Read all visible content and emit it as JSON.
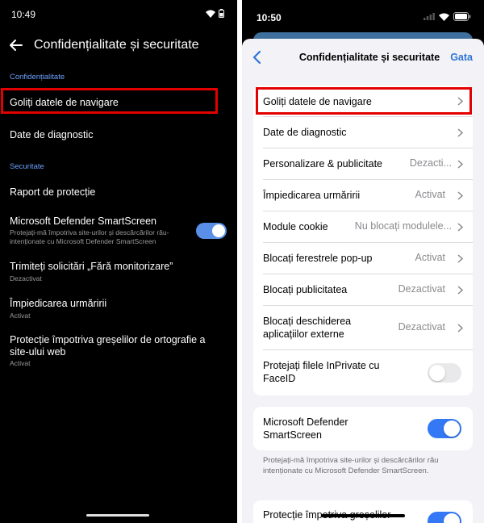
{
  "android": {
    "status_time": "10:49",
    "title": "Confidențialitate și securitate",
    "section_privacy": "Confidențialitate",
    "section_security": "Securitate",
    "items": [
      {
        "title": "Goliți datele de navigare"
      },
      {
        "title": "Date de diagnostic"
      },
      {
        "title": "Raport de protecție"
      },
      {
        "title": "Microsoft Defender SmartScreen",
        "subtitle": "Protejați-mă împotriva site-urilor și descărcărilor rău-intenționate cu Microsoft Defender SmartScreen",
        "toggle": true
      },
      {
        "title": "Trimiteți solicitări „Fără monitorizare”",
        "subtitle": "Dezactivat"
      },
      {
        "title": "Împiedicarea urmăririi",
        "subtitle": "Activat"
      },
      {
        "title": "Protecție împotriva greșelilor de ortografie a site-ului web",
        "subtitle": "Activat"
      }
    ],
    "colors": {
      "accent": "#6ea0ff",
      "toggle_on": "#5a8fe8",
      "highlight": "#e30000"
    }
  },
  "ios": {
    "status_time": "10:50",
    "title": "Confidențialitate și securitate",
    "done_label": "Gata",
    "rows": [
      {
        "label": "Goliți datele de navigare",
        "value": ""
      },
      {
        "label": "Date de diagnostic",
        "value": ""
      },
      {
        "label": "Personalizare & publicitate",
        "value": "Dezacti..."
      },
      {
        "label": "Împiedicarea urmăririi",
        "value": "Activat"
      },
      {
        "label": "Module cookie",
        "value": "Nu blocați modulele..."
      },
      {
        "label": "Blocați ferestrele pop-up",
        "value": "Activat"
      },
      {
        "label": "Blocați publicitatea",
        "value": "Dezactivat"
      },
      {
        "label": "Blocați deschiderea aplicațiilor externe",
        "value": "Dezactivat"
      },
      {
        "label": "Protejați filele InPrivate cu FaceID",
        "toggle": false
      }
    ],
    "smartscreen": {
      "label": "Microsoft Defender SmartScreen",
      "toggle": true
    },
    "smartscreen_footnote": "Protejați-mă împotriva site-urilor și descărcărilor rău intenționate cu Microsoft Defender SmartScreen.",
    "typo_protection": {
      "label": "Protecție împotriva greșelilor",
      "toggle": true
    },
    "colors": {
      "accent": "#2f74d6",
      "toggle_on": "#3478f6",
      "highlight": "#e30000"
    }
  }
}
